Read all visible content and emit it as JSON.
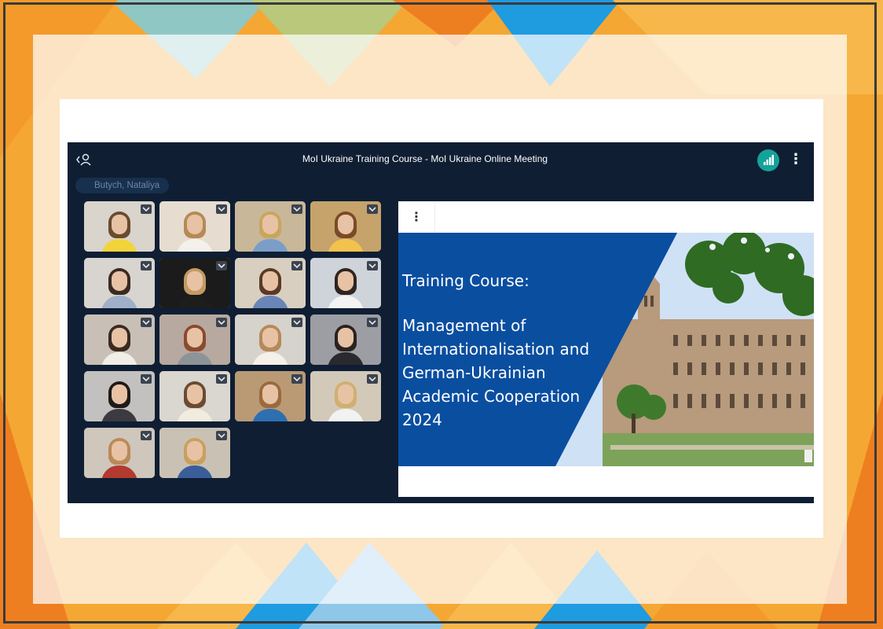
{
  "meeting": {
    "title": "MoI Ukraine Training Course - MoI Ukraine Online Meeting",
    "active_speaker": "Butych, Nataliya",
    "participant_count": 18
  },
  "slide": {
    "heading": "Training Course:",
    "body": "Management of\nInternationalisation and\nGerman-Ukrainian\nAcademic Cooperation\n2024"
  },
  "icons": {
    "back": "back-people-icon",
    "signal": "network-signal-icon",
    "more": "more-vertical-icon",
    "tile_menu": "chevron-down-icon"
  },
  "colors": {
    "meeting_bg": "#0f1e33",
    "signal_teal": "#14a39a",
    "slide_blue": "#0a4ea0",
    "frame_orange": "#f39a2b",
    "frame_blue": "#1f9be0"
  }
}
